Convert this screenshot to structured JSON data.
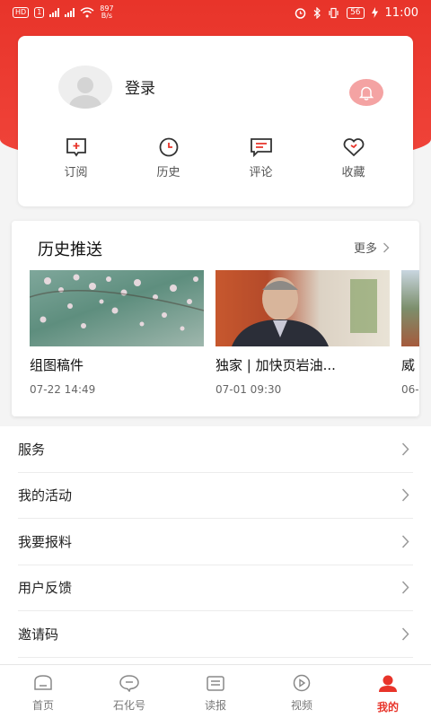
{
  "status_bar": {
    "badge_hd": "HD",
    "badge_1": "1",
    "net_speed": "897",
    "net_unit": "B/s",
    "battery": "56",
    "time": "11:00"
  },
  "profile": {
    "login_label": "登录",
    "shortcuts": [
      {
        "label": "订阅",
        "icon": "subscribe-icon"
      },
      {
        "label": "历史",
        "icon": "clock-icon"
      },
      {
        "label": "评论",
        "icon": "comment-icon"
      },
      {
        "label": "收藏",
        "icon": "heart-icon"
      }
    ]
  },
  "history": {
    "title": "历史推送",
    "more_label": "更多",
    "items": [
      {
        "title": "组图稿件",
        "time": "07-22 14:49"
      },
      {
        "title": "独家 | 加快页岩油...",
        "time": "07-01 09:30"
      },
      {
        "title": "威",
        "time": "06-"
      }
    ]
  },
  "menu": [
    {
      "label": "服务"
    },
    {
      "label": "我的活动"
    },
    {
      "label": "我要报料"
    },
    {
      "label": "用户反馈"
    },
    {
      "label": "邀请码"
    }
  ],
  "nav": [
    {
      "label": "首页",
      "icon": "home-icon"
    },
    {
      "label": "石化号",
      "icon": "chat-icon"
    },
    {
      "label": "读报",
      "icon": "newspaper-icon"
    },
    {
      "label": "视频",
      "icon": "video-icon"
    },
    {
      "label": "我的",
      "icon": "profile-icon",
      "active": true
    }
  ],
  "colors": {
    "accent": "#e8342a",
    "bell_bg": "#f4a3a3"
  }
}
